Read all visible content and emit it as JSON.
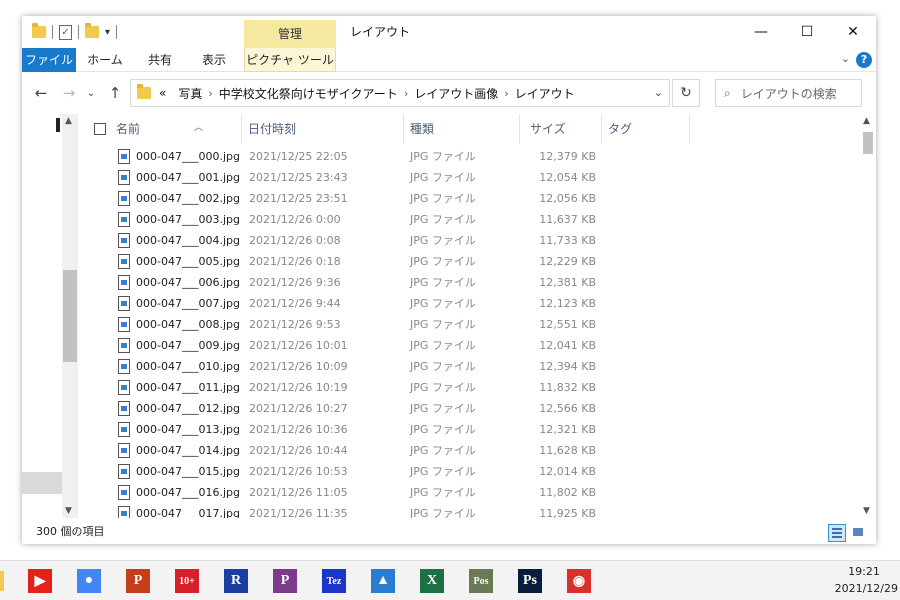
{
  "window": {
    "title": "レイアウト",
    "manage_tab": "管理",
    "minimize_icon": "—",
    "maximize_icon": "☐",
    "close_icon": "✕"
  },
  "ribbon": {
    "tabs": [
      "ファイル",
      "ホーム",
      "共有",
      "表示",
      "ピクチャ ツール"
    ],
    "collapse_icon": "⌄",
    "help_icon": "?"
  },
  "nav": {
    "back_icon": "←",
    "forward_icon": "→",
    "recent_icon": "⌄",
    "up_icon": "↑",
    "address_prefix": "«",
    "breadcrumbs": [
      "写真",
      "中学校文化祭向けモザイクアート",
      "レイアウト画像",
      "レイアウト"
    ],
    "address_dropdown_icon": "⌄",
    "refresh_icon": "↻",
    "search_placeholder": "レイアウトの検索",
    "search_icon": "⌕"
  },
  "columns": {
    "name": "名前",
    "date": "日付時刻",
    "type": "種類",
    "size": "サイズ",
    "tag": "タグ"
  },
  "files": [
    {
      "name": "000-047___000.jpg",
      "date": "2021/12/25 22:05",
      "type": "JPG ファイル",
      "size": "12,379 KB"
    },
    {
      "name": "000-047___001.jpg",
      "date": "2021/12/25 23:43",
      "type": "JPG ファイル",
      "size": "12,054 KB"
    },
    {
      "name": "000-047___002.jpg",
      "date": "2021/12/25 23:51",
      "type": "JPG ファイル",
      "size": "12,056 KB"
    },
    {
      "name": "000-047___003.jpg",
      "date": "2021/12/26 0:00",
      "type": "JPG ファイル",
      "size": "11,637 KB"
    },
    {
      "name": "000-047___004.jpg",
      "date": "2021/12/26 0:08",
      "type": "JPG ファイル",
      "size": "11,733 KB"
    },
    {
      "name": "000-047___005.jpg",
      "date": "2021/12/26 0:18",
      "type": "JPG ファイル",
      "size": "12,229 KB"
    },
    {
      "name": "000-047___006.jpg",
      "date": "2021/12/26 9:36",
      "type": "JPG ファイル",
      "size": "12,381 KB"
    },
    {
      "name": "000-047___007.jpg",
      "date": "2021/12/26 9:44",
      "type": "JPG ファイル",
      "size": "12,123 KB"
    },
    {
      "name": "000-047___008.jpg",
      "date": "2021/12/26 9:53",
      "type": "JPG ファイル",
      "size": "12,551 KB"
    },
    {
      "name": "000-047___009.jpg",
      "date": "2021/12/26 10:01",
      "type": "JPG ファイル",
      "size": "12,041 KB"
    },
    {
      "name": "000-047___010.jpg",
      "date": "2021/12/26 10:09",
      "type": "JPG ファイル",
      "size": "12,394 KB"
    },
    {
      "name": "000-047___011.jpg",
      "date": "2021/12/26 10:19",
      "type": "JPG ファイル",
      "size": "11,832 KB"
    },
    {
      "name": "000-047___012.jpg",
      "date": "2021/12/26 10:27",
      "type": "JPG ファイル",
      "size": "12,566 KB"
    },
    {
      "name": "000-047___013.jpg",
      "date": "2021/12/26 10:36",
      "type": "JPG ファイル",
      "size": "12,321 KB"
    },
    {
      "name": "000-047___014.jpg",
      "date": "2021/12/26 10:44",
      "type": "JPG ファイル",
      "size": "11,628 KB"
    },
    {
      "name": "000-047___015.jpg",
      "date": "2021/12/26 10:53",
      "type": "JPG ファイル",
      "size": "12,014 KB"
    },
    {
      "name": "000-047___016.jpg",
      "date": "2021/12/26 11:05",
      "type": "JPG ファイル",
      "size": "11,802 KB"
    },
    {
      "name": "000-047___017.jpg",
      "date": "2021/12/26 11:35",
      "type": "JPG ファイル",
      "size": "11,925 KB"
    }
  ],
  "status": {
    "item_count": "300 個の項目"
  },
  "taskbar": {
    "apps": [
      {
        "name": "youtube-icon",
        "color": "#e62117",
        "glyph": "▶"
      },
      {
        "name": "chrome-icon",
        "color": "#4285f4",
        "glyph": "●"
      },
      {
        "name": "powerpoint-icon",
        "color": "#c43e1c",
        "glyph": "P"
      },
      {
        "name": "badge-10plus-icon",
        "color": "#d6202a",
        "glyph": "10+"
      },
      {
        "name": "r-app-icon",
        "color": "#1a3fa0",
        "glyph": "R"
      },
      {
        "name": "p-app-icon",
        "color": "#7b3b8a",
        "glyph": "P"
      },
      {
        "name": "tez-app-icon",
        "color": "#1a35c9",
        "glyph": "Tez"
      },
      {
        "name": "photos-icon",
        "color": "#2a7ccf",
        "glyph": "▲"
      },
      {
        "name": "excel-icon",
        "color": "#1d7044",
        "glyph": "X"
      },
      {
        "name": "pos-app-icon",
        "color": "#6a7a55",
        "glyph": "Pos"
      },
      {
        "name": "photoshop-icon",
        "color": "#0a1d3c",
        "glyph": "Ps"
      },
      {
        "name": "camera-app-icon",
        "color": "#d9302b",
        "glyph": "◉"
      }
    ],
    "time": "19:21",
    "date": "2021/12/29"
  },
  "colors": {
    "accent": "#1979ca",
    "manage_tab": "#f5e9a0",
    "header_text": "#4c607a",
    "secondary_text": "#888888"
  }
}
